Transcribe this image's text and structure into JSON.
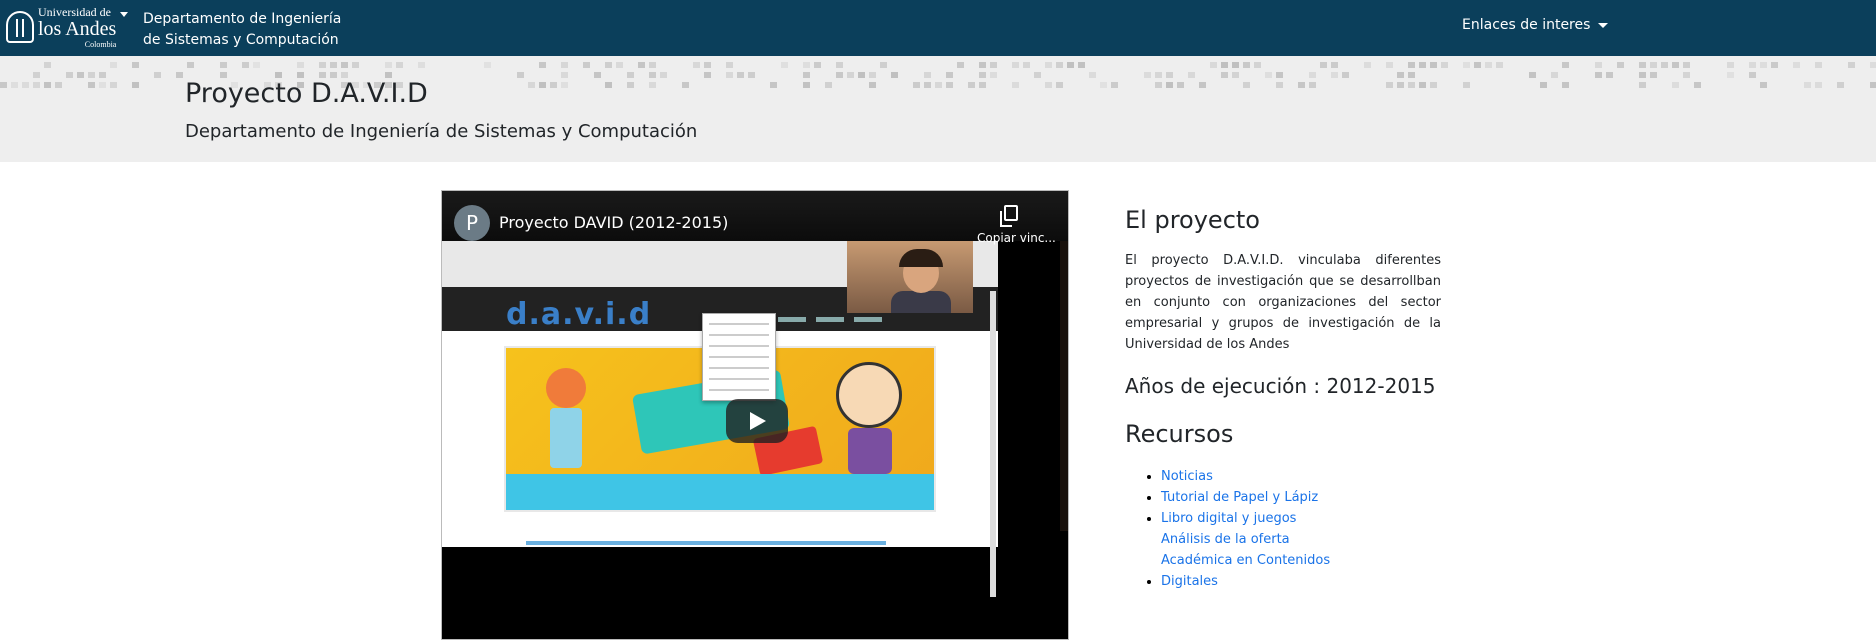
{
  "nav": {
    "logo_line1": "Universidad de",
    "logo_line2": "los Andes",
    "logo_line3": "Colombia",
    "dept_line1": "Departamento de Ingeniería",
    "dept_line2": "de Sistemas y Computación",
    "links_label": "Enlaces de interes"
  },
  "header": {
    "title": "Proyecto D.A.V.I.D",
    "subtitle": "Departamento de Ingeniería de Sistemas y Computación"
  },
  "video": {
    "channel_initial": "P",
    "title": "Proyecto DAVID (2012-2015)",
    "copy_label": "Copiar vinc..."
  },
  "project": {
    "heading": "El proyecto",
    "description": "El proyecto D.A.V.I.D. vinculaba diferentes proyectos de investigación que se desarrollban en conjunto con organizaciones del sector empresarial y grupos de investigación de la Universidad de los Andes",
    "years": "Años de ejecución : 2012-2015",
    "resources_heading": "Recursos",
    "resources": [
      "Noticias",
      "Tutorial de Papel y Lápiz",
      "Libro digital y juegos",
      "Análisis de la oferta Académica en Contenidos Digitales"
    ]
  },
  "colors": {
    "nav_bg": "#0b3f5b",
    "band_bg": "#eeeeee",
    "link": "#1a73e8"
  }
}
